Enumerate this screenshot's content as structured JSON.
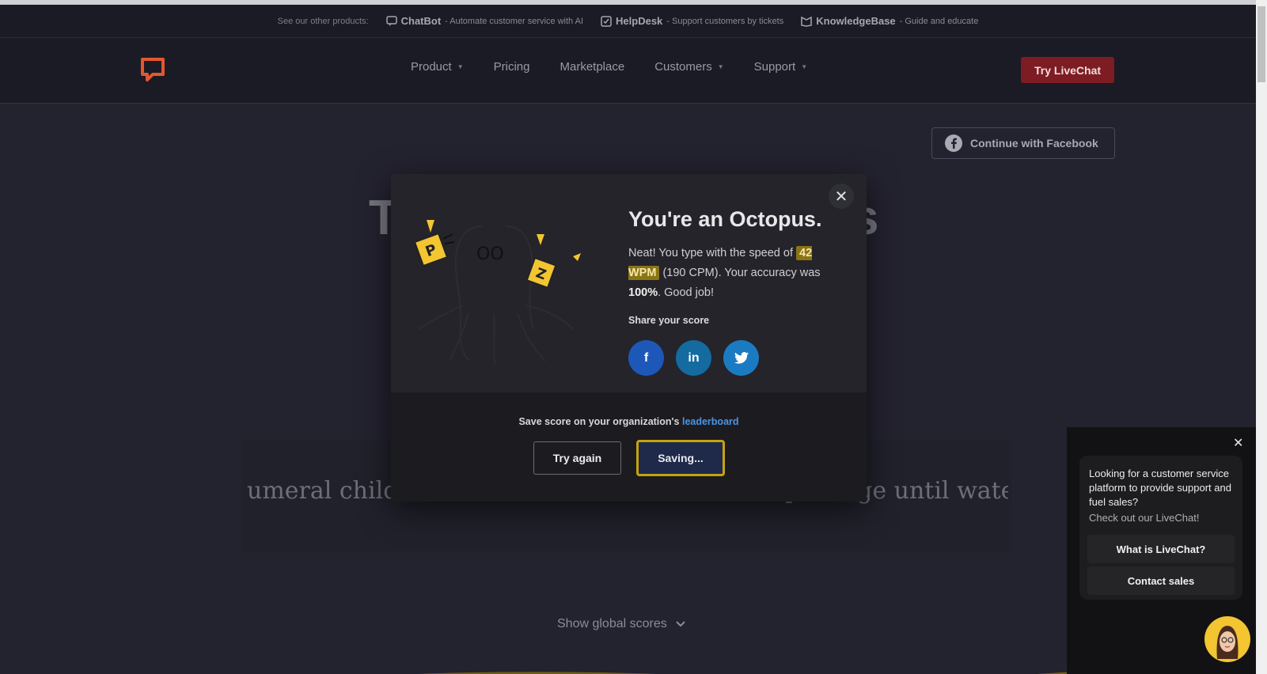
{
  "announcement": {
    "lead": "See our other products:",
    "products": [
      {
        "name": "ChatBot",
        "desc": " - Automate customer service with AI"
      },
      {
        "name": "HelpDesk",
        "desc": " - Support customers by tickets"
      },
      {
        "name": "KnowledgeBase",
        "desc": " - Guide and educate"
      }
    ]
  },
  "header": {
    "nav": [
      {
        "label": "Product",
        "caret": "▼"
      },
      {
        "label": "Pricing",
        "caret": ""
      },
      {
        "label": "Marketplace",
        "caret": ""
      },
      {
        "label": "Customers",
        "caret": "▼"
      },
      {
        "label": "Support",
        "caret": "▼"
      }
    ],
    "cta": "Try LiveChat",
    "brand_color": "#e4572e"
  },
  "page": {
    "facebook_button": "Continue with Facebook",
    "title_left": "T",
    "title_right": "s",
    "typing_before": "umeral children mineral decide ",
    "typing_cursor": "s",
    "typing_after": "chool class port age until water w",
    "global_scores": "Show global scores"
  },
  "modal": {
    "title": "You're an Octopus.",
    "body_pre": "Neat! You type with the speed of",
    "wpm": "42 WPM",
    "cpm": " (190 CPM). Your accuracy was ",
    "accuracy": "100%",
    "body_post": ". Good job!",
    "share_label": "Share your score",
    "share": [
      {
        "icon": "facebook-icon",
        "glyph": "f"
      },
      {
        "icon": "linkedin-icon",
        "glyph": "in"
      },
      {
        "icon": "twitter-icon",
        "glyph": ""
      }
    ],
    "save_text": "Save score on your organization's ",
    "save_link": "leaderboard",
    "try_again": "Try again",
    "saving": "Saving...",
    "close": "✕"
  },
  "chat_widget": {
    "message": "Looking for a customer service platform to provide support and fuel sales?",
    "sub": "Check out our LiveChat!",
    "btn_what": "What is LiveChat?",
    "btn_contact": "Contact sales",
    "close": "✕"
  },
  "colors": {
    "accent_yellow": "#c7a20e",
    "link_blue": "#4b94e8",
    "cta_red": "#7e1c24"
  }
}
